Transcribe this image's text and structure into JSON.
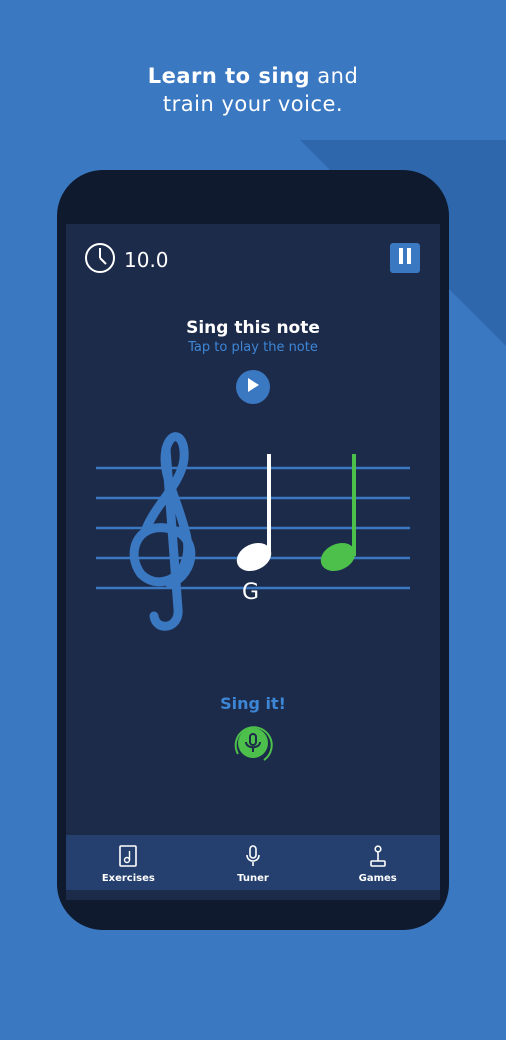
{
  "headline": {
    "bold": "Learn to sing",
    "rest": "and",
    "line2": "train your voice."
  },
  "timer": {
    "icon": "clock-icon",
    "value": "10.0"
  },
  "pause": {
    "icon": "pause-icon"
  },
  "prompt": {
    "title": "Sing this note",
    "subtitle": "Tap to play the note"
  },
  "play": {
    "icon": "play-icon"
  },
  "staff": {
    "clef": "treble-clef",
    "target_note_name": "G"
  },
  "sing": {
    "label": "Sing it!",
    "icon": "microphone-icon"
  },
  "nav": {
    "items": [
      {
        "label": "Exercises",
        "icon": "exercises-icon"
      },
      {
        "label": "Tuner",
        "icon": "microphone-icon"
      },
      {
        "label": "Games",
        "icon": "joystick-icon"
      }
    ]
  },
  "colors": {
    "accent": "#3a78c2",
    "screen": "#1d2b4a",
    "success": "#4cc04a",
    "nav": "#25406e"
  }
}
